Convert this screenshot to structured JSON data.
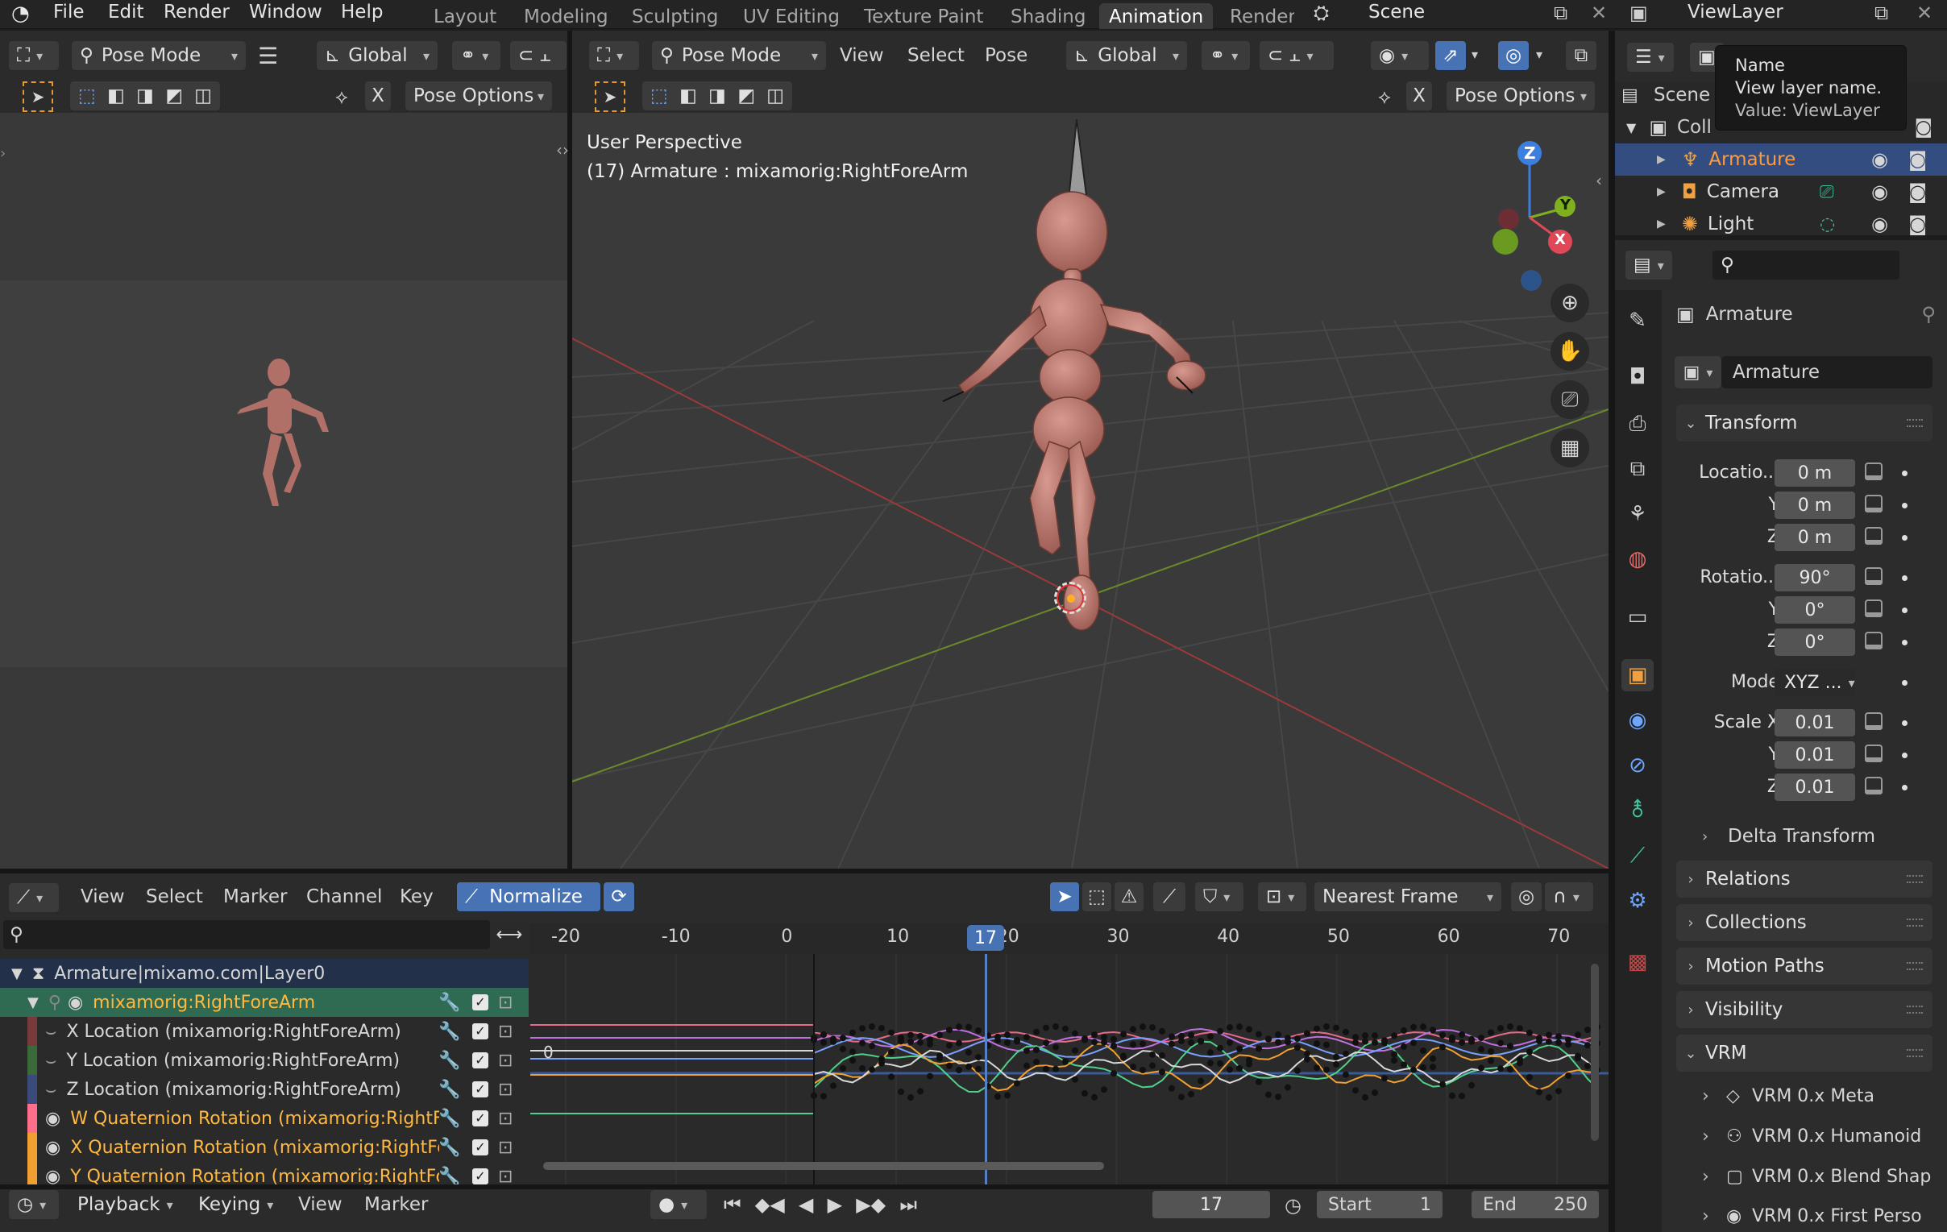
{
  "topbar": {
    "menus": [
      "File",
      "Edit",
      "Render",
      "Window",
      "Help"
    ],
    "workspaces": [
      "Layout",
      "Modeling",
      "Sculpting",
      "UV Editing",
      "Texture Paint",
      "Shading",
      "Animation",
      "Renderi"
    ],
    "active_workspace": "Animation",
    "scene_label": "Scene",
    "viewlayer_label": "ViewLayer"
  },
  "tooltip": {
    "name": "Name",
    "desc": "View layer name.",
    "value": "Value: ViewLayer"
  },
  "left_view": {
    "mode": "Pose Mode",
    "orientation": "Global",
    "x_label": "X",
    "pose_options": "Pose Options"
  },
  "main_view": {
    "mode": "Pose Mode",
    "menu": [
      "View",
      "Select",
      "Pose"
    ],
    "orientation": "Global",
    "x_label": "X",
    "pose_options": "Pose Options",
    "overlay_title": "User Perspective",
    "overlay_sub": "(17) Armature : mixamorig:RightForeArm",
    "gizmo": {
      "z": "Z",
      "y": "Y",
      "x": "X"
    }
  },
  "outliner": {
    "scene_label": "Scene C",
    "collection_label": "Coll",
    "items": [
      {
        "label": "Armature",
        "color": "#ff9a3c",
        "active": true
      },
      {
        "label": "Camera",
        "color": "#dedede",
        "active": false
      },
      {
        "label": "Light",
        "color": "#dedede",
        "active": false
      }
    ]
  },
  "properties": {
    "object_header": "Armature",
    "object_name": "Armature",
    "transform_title": "Transform",
    "location_label": "Locatio...",
    "location": [
      "0 m",
      "0 m",
      "0 m"
    ],
    "rotation_label": "Rotatio...",
    "rotation": [
      "90°",
      "0°",
      "0°"
    ],
    "mode_label": "Mode",
    "mode_value": "XYZ ...",
    "scale_label": "Scale X",
    "scale": [
      "0.01",
      "0.01",
      "0.01"
    ],
    "axis_y": "Y",
    "axis_z": "Z",
    "delta": "Delta Transform",
    "sections": [
      "Relations",
      "Collections",
      "Motion Paths",
      "Visibility"
    ],
    "vrm_title": "VRM",
    "vrm_items": [
      "VRM 0.x Meta",
      "VRM 0.x Humanoid",
      "VRM 0.x Blend Shap",
      "VRM 0.x First Perso"
    ]
  },
  "graph_editor": {
    "menu": [
      "View",
      "Select",
      "Marker",
      "Channel",
      "Key"
    ],
    "normalize": "Normalize",
    "snap": "Nearest Frame",
    "ruler": [
      "-20",
      "-10",
      "0",
      "10",
      "20",
      "30",
      "40",
      "50",
      "60",
      "70"
    ],
    "current_frame": "17",
    "zero_label": "0",
    "channels": [
      {
        "label": "Armature|mixamo.com|Layer0",
        "kind": "action"
      },
      {
        "label": "mixamorig:RightForeArm",
        "kind": "group"
      },
      {
        "label": "X Location (mixamorig:RightForeArm)",
        "kind": "curve",
        "color": "#7a3a3a"
      },
      {
        "label": "Y Location (mixamorig:RightForeArm)",
        "kind": "curve",
        "color": "#3a6a3a"
      },
      {
        "label": "Z Location (mixamorig:RightForeArm)",
        "kind": "curve",
        "color": "#3a4a7a"
      },
      {
        "label": "W Quaternion Rotation (mixamorig:RightF",
        "kind": "rot",
        "color": "#ff6e8a"
      },
      {
        "label": "X Quaternion Rotation (mixamorig:RightFo",
        "kind": "rot",
        "color": "#f0a030"
      },
      {
        "label": "Y Quaternion Rotation (mixamorig:RightFo",
        "kind": "rot",
        "color": "#f0a030"
      }
    ]
  },
  "timeline": {
    "menus": [
      "Playback",
      "Keying",
      "View",
      "Marker"
    ],
    "frame": "17",
    "start_label": "Start",
    "start": "1",
    "end_label": "End",
    "end": "250"
  }
}
